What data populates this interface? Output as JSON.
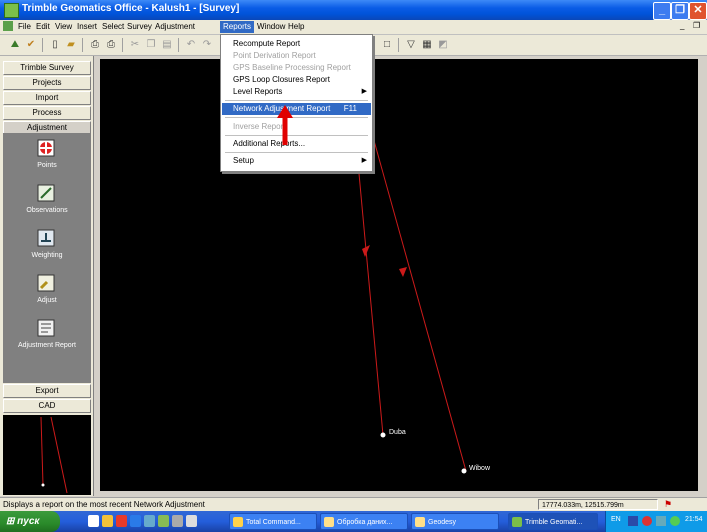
{
  "window": {
    "title": "Trimble Geomatics Office - Kalush1 - [Survey]"
  },
  "menubar": {
    "items": [
      "File",
      "Edit",
      "View",
      "Insert",
      "Select",
      "Survey",
      "Adjustment",
      "Reports",
      "Window",
      "Help"
    ],
    "active": "Reports"
  },
  "sidebar": {
    "top_buttons": [
      "Trimble Survey",
      "Projects",
      "Import",
      "Process",
      "Adjustment"
    ],
    "tools": [
      "Points",
      "Observations",
      "Weighting",
      "Adjust",
      "Adjustment Report"
    ],
    "bottom_buttons": [
      "Export",
      "CAD"
    ]
  },
  "reports_menu": {
    "items": [
      {
        "label": "Recompute Report",
        "enabled": true
      },
      {
        "label": "Point Derivation Report",
        "enabled": false
      },
      {
        "label": "GPS Baseline Processing Report",
        "enabled": false
      },
      {
        "label": "GPS Loop Closures Report",
        "enabled": true
      },
      {
        "label": "Level Reports",
        "enabled": true,
        "submenu": true
      },
      {
        "label": "Network Adjustment Report",
        "shortcut": "F11",
        "enabled": true,
        "highlighted": true
      },
      {
        "label": "Inverse Report",
        "enabled": false
      },
      {
        "label": "Additional Reports...",
        "enabled": true
      },
      {
        "label": "Setup",
        "enabled": true,
        "submenu": true
      }
    ]
  },
  "map": {
    "points": [
      {
        "label": "Duba"
      },
      {
        "label": "Wibow"
      }
    ],
    "colors": {
      "background": "#000000",
      "lines": "#cc1a1a",
      "points": "#ffffff",
      "annotation_arrow": "#e00000"
    }
  },
  "statusbar": {
    "text": "Displays a report on the most recent Network Adjustment",
    "coordinates": "17774.033m, 12515.799m"
  },
  "taskbar": {
    "start_label": "пуск",
    "tasks": [
      "Total Command...",
      "Обробка даних...",
      "Geodesy",
      "Trimble Geomati..."
    ],
    "active_task": "Trimble Geomati...",
    "language": "EN",
    "clock": "21:54"
  }
}
